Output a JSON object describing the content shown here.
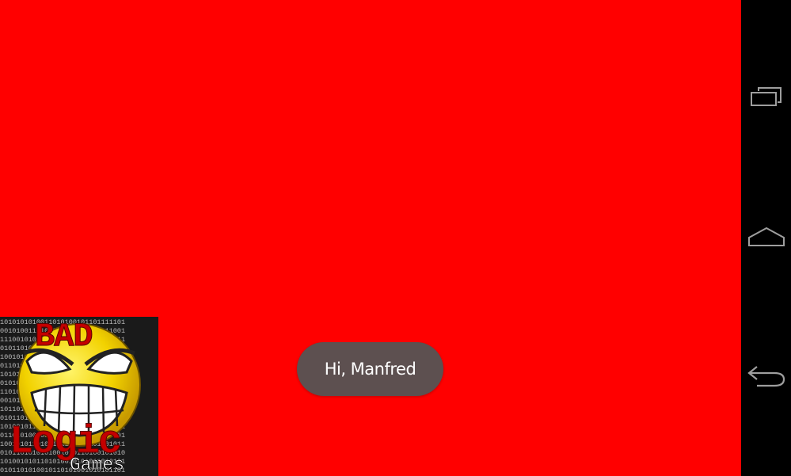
{
  "app": {
    "background_color": "#ff0000"
  },
  "toast": {
    "message": "Hi, Manfred",
    "background_color": "#5d5050"
  },
  "ad_banner": {
    "logo_word_1": "BAD",
    "logo_word_2": "Logic",
    "logo_word_3": "Games",
    "mascot_icon": "grinning-smiley-icon"
  },
  "nav_bar": {
    "buttons": [
      {
        "icon": "recent-apps-icon"
      },
      {
        "icon": "home-icon"
      },
      {
        "icon": "back-icon"
      }
    ]
  }
}
